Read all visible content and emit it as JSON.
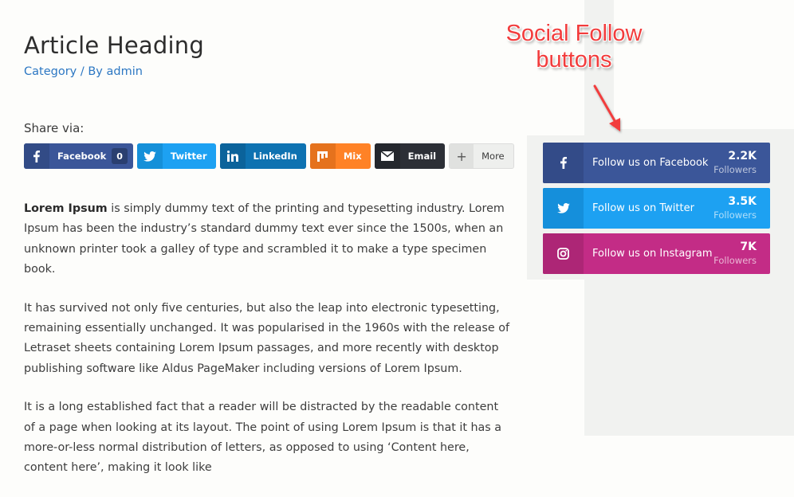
{
  "article": {
    "title": "Article Heading",
    "category": "Category",
    "separator": " / By ",
    "author": "admin"
  },
  "share": {
    "label": "Share via:",
    "buttons": [
      {
        "network": "Facebook",
        "label": "Facebook",
        "icon": "facebook-icon",
        "count": "0",
        "color": "#3b5699"
      },
      {
        "network": "Twitter",
        "label": "Twitter",
        "icon": "twitter-icon",
        "color": "#1da1f2"
      },
      {
        "network": "LinkedIn",
        "label": "LinkedIn",
        "icon": "linkedin-icon",
        "color": "#0e72b1"
      },
      {
        "network": "Mix",
        "label": "Mix",
        "icon": "mix-icon",
        "color": "#ff8226"
      },
      {
        "network": "Email",
        "label": "Email",
        "icon": "email-icon",
        "color": "#2c2f36"
      },
      {
        "network": "More",
        "label": "More",
        "icon": "plus-icon",
        "color": "#eeefed"
      }
    ]
  },
  "content": {
    "paragraphs": [
      {
        "bold": "Lorem Ipsum",
        "text": " is simply dummy text of the printing and typesetting industry. Lorem Ipsum has been the industry’s standard dummy text ever since the 1500s, when an unknown printer took a galley of type and scrambled it to make a type specimen book."
      },
      {
        "text": "It has survived not only five centuries, but also the leap into electronic typesetting, remaining essentially unchanged. It was popularised in the 1960s with the release of Letraset sheets containing Lorem Ipsum passages, and more recently with desktop publishing software like Aldus PageMaker including versions of Lorem Ipsum."
      },
      {
        "text": "It is a long established fact that a reader will be distracted by the readable content of a page when looking at its layout. The point of using Lorem Ipsum is that it has a more-or-less normal distribution of letters, as opposed to using ‘Content here, content here’, making it look like"
      }
    ]
  },
  "annotation": {
    "line1": "Social Follow",
    "line2": "buttons",
    "color": "#f23c3c"
  },
  "follow": {
    "items": [
      {
        "network": "Facebook",
        "label": "Follow us on Facebook",
        "count": "2.2K",
        "unit": "Followers",
        "icon": "facebook-icon",
        "color": "#3b5699"
      },
      {
        "network": "Twitter",
        "label": "Follow us on Twitter",
        "count": "3.5K",
        "unit": "Followers",
        "icon": "twitter-icon",
        "color": "#1da1f2"
      },
      {
        "network": "Instagram",
        "label": "Follow us on Instagram",
        "count": "7K",
        "unit": "Followers",
        "icon": "instagram-icon",
        "color": "#c32c86"
      }
    ]
  }
}
